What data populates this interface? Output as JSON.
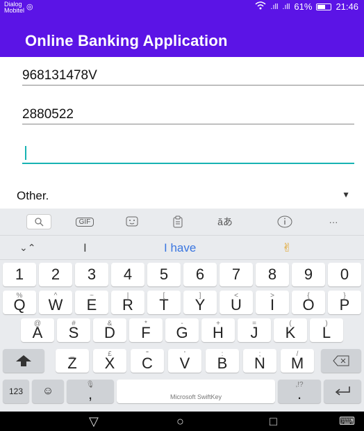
{
  "status_bar": {
    "carrier": "Dialog\nMobitel",
    "carrier_icon": "◎",
    "signal": "…ıl  …ıl",
    "battery_pct": "61%",
    "time": "21:46",
    "wifi_icon": "wifi-icon",
    "battery_level": 0.61
  },
  "app_bar": {
    "title": "Online Banking Application"
  },
  "form": {
    "nic_value": "968131478V",
    "account_value": "2880522",
    "amount_value": "",
    "dropdown_value": "Other."
  },
  "keyboard": {
    "toolbar": [
      "search-icon",
      "GIF",
      "sticker-icon",
      "clipboard-icon",
      "translate-icon",
      "info-icon",
      "..."
    ],
    "toolbar_gif": "GIF",
    "toolbar_more": "···",
    "suggestions": {
      "left": "I",
      "main": "I have",
      "right": "✌"
    },
    "numbers": [
      "1",
      "2",
      "3",
      "4",
      "5",
      "6",
      "7",
      "8",
      "9",
      "0"
    ],
    "row1": [
      [
        "%",
        "Q"
      ],
      [
        "^",
        "W"
      ],
      [
        "~",
        "E"
      ],
      [
        "|",
        "R"
      ],
      [
        "[",
        "T"
      ],
      [
        "]",
        "Y"
      ],
      [
        "<",
        "U"
      ],
      [
        ">",
        "I"
      ],
      [
        "{",
        "O"
      ],
      [
        "}",
        "P"
      ]
    ],
    "row2": [
      [
        "@",
        "A"
      ],
      [
        "#",
        "S"
      ],
      [
        "&",
        "D"
      ],
      [
        "*",
        "F"
      ],
      [
        "-",
        "G"
      ],
      [
        "+",
        "H"
      ],
      [
        "=",
        "J"
      ],
      [
        "(",
        "K"
      ],
      [
        ")",
        "L"
      ]
    ],
    "row3": [
      [
        "_",
        "Z"
      ],
      [
        "£",
        "X"
      ],
      [
        "\"",
        "C"
      ],
      [
        "'",
        "V"
      ],
      [
        ":",
        "B"
      ],
      [
        ";",
        "N"
      ],
      [
        "/",
        "M"
      ]
    ],
    "bottom": {
      "mode": "123",
      "emoji": "☺",
      "comma": ",",
      "space_label": "Microsoft SwiftKey",
      "period": ".",
      "period_sub": ",!?"
    }
  },
  "nav": {
    "back": "▽",
    "home": "○",
    "recents": "□",
    "keyboard": "⌨"
  }
}
